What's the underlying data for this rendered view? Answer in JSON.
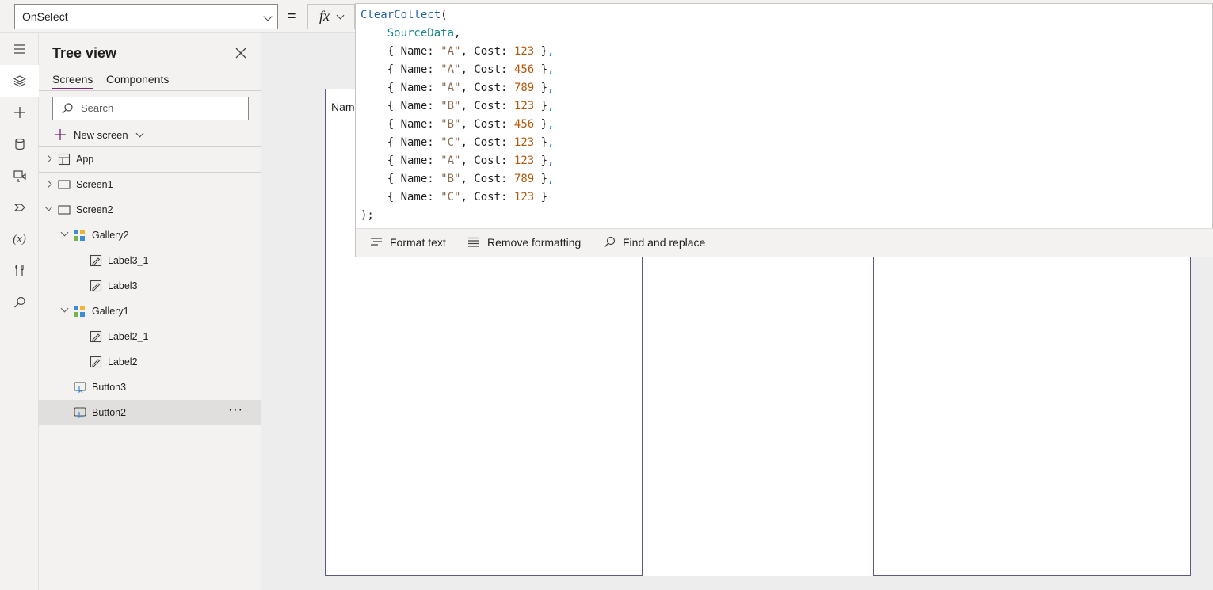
{
  "formula_bar": {
    "property": "OnSelect",
    "equals": "=",
    "fx": "fx"
  },
  "formula_lines": [
    "ClearCollect(",
    "    SourceData,",
    "    { Name: \"A\", Cost: 123 },",
    "    { Name: \"A\", Cost: 456 },",
    "    { Name: \"A\", Cost: 789 },",
    "    { Name: \"B\", Cost: 123 },",
    "    { Name: \"B\", Cost: 456 },",
    "    { Name: \"C\", Cost: 123 },",
    "    { Name: \"A\", Cost: 123 },",
    "    { Name: \"B\", Cost: 789 },",
    "    { Name: \"C\", Cost: 123 }",
    ");"
  ],
  "formula_tools": {
    "format": "Format text",
    "remove": "Remove formatting",
    "find": "Find and replace"
  },
  "tree": {
    "title": "Tree view",
    "tabs": {
      "screens": "Screens",
      "components": "Components"
    },
    "search_placeholder": "Search",
    "new_screen": "New screen",
    "nodes": [
      {
        "label": "App",
        "icon": "app-icon"
      },
      {
        "label": "Screen1",
        "icon": "screen-icon"
      },
      {
        "label": "Screen2",
        "icon": "screen-icon"
      },
      {
        "label": "Gallery2",
        "icon": "gallery-icon"
      },
      {
        "label": "Label3_1",
        "icon": "label-icon"
      },
      {
        "label": "Label3",
        "icon": "label-icon"
      },
      {
        "label": "Gallery1",
        "icon": "gallery-icon"
      },
      {
        "label": "Label2_1",
        "icon": "label-icon"
      },
      {
        "label": "Label2",
        "icon": "label-icon"
      },
      {
        "label": "Button3",
        "icon": "button-icon"
      },
      {
        "label": "Button2",
        "icon": "button-icon"
      }
    ],
    "selected": "Button2",
    "more": "···"
  },
  "canvas": {
    "label_partial": "Nam"
  },
  "rail_icons": [
    "hamburger-icon",
    "layers-icon",
    "plus-icon",
    "database-icon",
    "media-icon",
    "automate-icon",
    "variables-icon",
    "tools-icon",
    "search-icon"
  ],
  "rail_variables_text": "(x)",
  "colors": {
    "accent": "#742774",
    "selected_row": "#e1dfdd"
  }
}
